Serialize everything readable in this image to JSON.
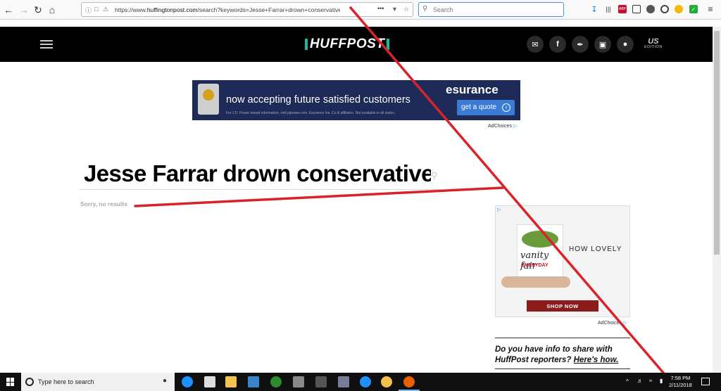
{
  "browser": {
    "url_prefix": "https://www.",
    "url_domain": "huffingtonpost.com",
    "url_rest": "/search?keywords=Jesse+Farrar+drown+conservative",
    "more_label": "•••",
    "search_placeholder": "Search"
  },
  "header": {
    "logo": "HUFFPOST",
    "edition_code": "US",
    "edition_label": "EDITION",
    "social": [
      "email-icon",
      "facebook-icon",
      "twitter-icon",
      "instagram-icon",
      "snapchat-icon"
    ]
  },
  "ad_banner": {
    "headline": "now accepting future satisfied customers",
    "brand": "esurance",
    "cta": "get a quote",
    "fineprint": "For J.D. Power award information, visit jdpower.com. Esurance Ins. Co & affiliates. Not available in all states.",
    "adchoices": "AdChoices"
  },
  "search": {
    "query": "Jesse Farrar drown conservative",
    "no_results": "Sorry, no results"
  },
  "side_ad": {
    "brand": "vanity fair",
    "sub": "EVERYDAY",
    "tagline": "HOW LOVELY",
    "cta": "SHOP NOW",
    "adchoices": "AdChoices"
  },
  "info_box": {
    "text": "Do you have info to share with HuffPost reporters?",
    "link": "Here's how."
  },
  "taskbar": {
    "search_placeholder": "Type here to search",
    "time": "7:58 PM",
    "date": "2/11/2018"
  },
  "colors": {
    "huffpost_green": "#0dbe98",
    "annotation_red": "#d9232a",
    "esurance_navy": "#1d2a57"
  }
}
